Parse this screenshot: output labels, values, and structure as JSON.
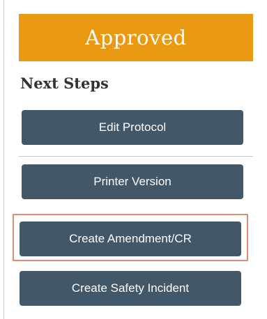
{
  "colors": {
    "status_banner": "#EA9A12",
    "button": "#425767",
    "highlight": "#E08A6F",
    "heading": "#333333"
  },
  "status": {
    "label": "Approved"
  },
  "next_steps": {
    "heading": "Next Steps",
    "actions": [
      {
        "label": "Edit Protocol"
      },
      {
        "label": "Printer Version"
      },
      {
        "label": "Create Amendment/CR",
        "highlighted": true
      },
      {
        "label": "Create Safety Incident"
      }
    ]
  }
}
